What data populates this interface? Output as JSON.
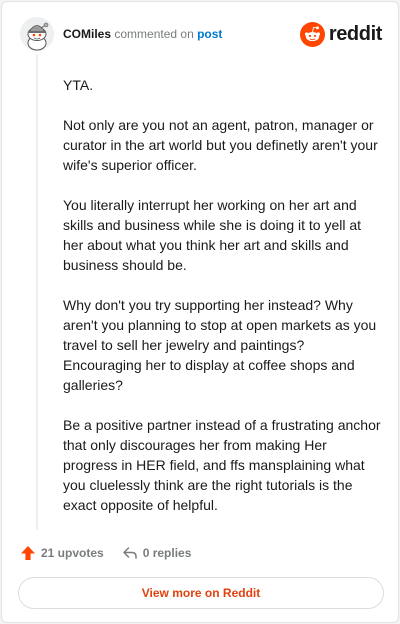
{
  "header": {
    "author": "COMiles",
    "action_text": "commented on",
    "target_link": "post",
    "brand_name": "reddit"
  },
  "comment": {
    "paragraphs": [
      "YTA.",
      "Not only are you not an agent, patron, manager or curator in the art world but you definetly aren't your wife's superior officer.",
      "You literally interrupt her working on her art and skills and business while she is doing it to yell at her about what you think her art and skills and business should be.",
      "Why don't you try supporting her instead? Why aren't you planning to stop at open markets as you travel to sell her jewelry and paintings? Encouraging her to display at coffee shops and galleries?",
      "Be a positive partner instead of a frustrating anchor that only discourages her from making Her progress in HER field, and ffs mansplaining what you cluelessly think are the right tutorials is the exact opposite of helpful."
    ]
  },
  "actions": {
    "upvotes": "21 upvotes",
    "replies": "0 replies"
  },
  "footer": {
    "view_button": "View more on Reddit"
  },
  "colors": {
    "accent": "#ff4500",
    "link": "#0079d3",
    "muted": "#787c7e",
    "button_text": "#e0410f"
  },
  "icons": {
    "avatar": "snoo-avatar-icon",
    "brand": "reddit-logo-icon",
    "upvote": "upvote-arrow-icon",
    "reply": "reply-arrow-icon"
  }
}
